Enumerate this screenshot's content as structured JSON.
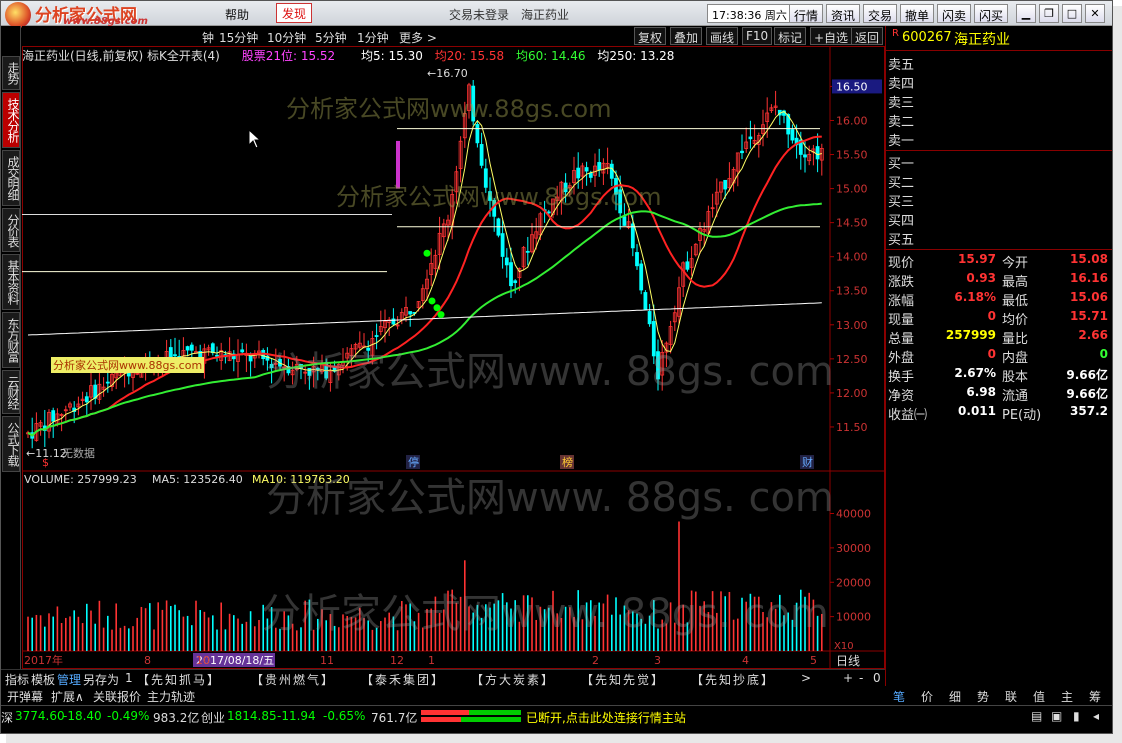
{
  "app": {
    "brand": "分析家公式网",
    "brand_url": "www.88gs.com",
    "menu_help": "帮助",
    "menu_discover": "发现",
    "trade_status": "交易未登录",
    "stock_title": "海正药业",
    "clock": "17:38:36 周六",
    "top_buttons": [
      "行情",
      "资讯",
      "交易",
      "撤单",
      "闪卖",
      "闪买"
    ]
  },
  "left_tabs": [
    "走势",
    "技术分析",
    "成交明细",
    "分价表",
    "基本资料",
    "东方财富",
    "云财经",
    "公式下载"
  ],
  "period_bar": {
    "periods": [
      "钟",
      "15分钟",
      "10分钟",
      "5分钟",
      "1分钟",
      "更多 >"
    ],
    "tools": [
      "复权",
      "叠加",
      "画线",
      "F10",
      "标记",
      "+自选",
      "返回"
    ]
  },
  "chart_header": {
    "name": "海正药业(日线,前复权) 标K全开表(4)",
    "items": [
      {
        "label": "股票21位: 15.52",
        "color": "#ff44ff"
      },
      {
        "label": "均5: 15.30",
        "color": "#ffffff"
      },
      {
        "label": "均20: 15.58",
        "color": "#ff3333"
      },
      {
        "label": "均60: 14.46",
        "color": "#33ff33"
      },
      {
        "label": "均250: 13.28",
        "color": "#ffffff"
      }
    ]
  },
  "chart_data": {
    "type": "candlestick",
    "y_ticks": [
      "16.50",
      "16.00",
      "15.50",
      "15.00",
      "14.50",
      "14.00",
      "13.50",
      "13.00",
      "12.50",
      "12.00",
      "11.50"
    ],
    "high_label": "16.70",
    "low_label": "11.12",
    "current_price_tag": "16.50",
    "x_labels": [
      "2017年",
      "8",
      "2017/08/18/五",
      "10",
      "11",
      "12",
      "1",
      "2",
      "3",
      "4",
      "5"
    ],
    "markers": [
      "停",
      "榜",
      "财"
    ],
    "no_data_label": "无数据",
    "period_label": "日线",
    "price_ylim": [
      11.0,
      16.8
    ],
    "volume_ticks": [
      "40000",
      "30000",
      "20000",
      "10000"
    ],
    "volume_unit": "X10",
    "volume_ylim": [
      0,
      48000
    ],
    "volume_header": {
      "volume": "VOLUME: 257999.23",
      "ma5": "MA5: 123526.40",
      "ma10": "MA10: 119763.20"
    }
  },
  "quote": {
    "code": "600267",
    "name": "海正药业",
    "sell_levels": [
      "卖五",
      "卖四",
      "卖三",
      "卖二",
      "卖一"
    ],
    "buy_levels": [
      "买一",
      "买二",
      "买三",
      "买四",
      "买五"
    ],
    "rows": [
      {
        "l1": "现价",
        "v1": "15.97",
        "c1": "#ff3333",
        "l2": "今开",
        "v2": "15.08",
        "c2": "#ff3333"
      },
      {
        "l1": "涨跌",
        "v1": "0.93",
        "c1": "#ff3333",
        "l2": "最高",
        "v2": "16.16",
        "c2": "#ff3333"
      },
      {
        "l1": "涨幅",
        "v1": "6.18%",
        "c1": "#ff3333",
        "l2": "最低",
        "v2": "15.06",
        "c2": "#ff3333"
      },
      {
        "l1": "现量",
        "v1": "0",
        "c1": "#ff3333",
        "l2": "均价",
        "v2": "15.71",
        "c2": "#ff3333"
      },
      {
        "l1": "总量",
        "v1": "257999",
        "c1": "#ffff00",
        "l2": "量比",
        "v2": "2.66",
        "c2": "#ff3333"
      },
      {
        "l1": "外盘",
        "v1": "0",
        "c1": "#ff3333",
        "l2": "内盘",
        "v2": "0",
        "c2": "#33ff33"
      },
      {
        "l1": "换手",
        "v1": "2.67%",
        "c1": "#ffffff",
        "l2": "股本",
        "v2": "9.66亿",
        "c2": "#ffffff"
      },
      {
        "l1": "净资",
        "v1": "6.98",
        "c1": "#ffffff",
        "l2": "流通",
        "v2": "9.66亿",
        "c2": "#ffffff"
      },
      {
        "l1": "收益㈠",
        "v1": "0.011",
        "c1": "#ffffff",
        "l2": "PE(动)",
        "v2": "357.2",
        "c2": "#ffffff"
      }
    ]
  },
  "bottom_tabs": [
    "指标",
    "模板",
    "管理",
    "另存为",
    "1",
    "【先知抓马】",
    "【贵州燃气】",
    "【泰禾集团】",
    "【方大炭素】",
    "【先知先觉】",
    "【先知抄底】",
    ">"
  ],
  "bottom2": [
    "开弹幕",
    "扩展∧",
    "关联报价",
    "主力轨迹"
  ],
  "right_tabs": [
    "笔",
    "价",
    "细",
    "势",
    "联",
    "值",
    "主",
    "筹"
  ],
  "status": {
    "idx1_name": "深",
    "idx1_value": "3774.60",
    "idx1_change": "-18.40",
    "idx1_pct": "-0.49%",
    "idx1_amount": "983.2亿",
    "idx2_name": "创业",
    "idx2_value": "1814.85",
    "idx2_change": "-11.94",
    "idx2_pct": "-0.65%",
    "idx2_amount": "761.7亿",
    "message": "已断开,点击此处连接行情主站"
  },
  "watermarks": {
    "main": "分析家公式网www.88gs.com",
    "wide": "分析家公式网www. 88gs. com",
    "label": "分析家公式网www.88gs.com"
  },
  "colors": {
    "up": "#ff3333",
    "down": "#00ffff",
    "ma5": "#ffff66",
    "ma20": "#ff2222",
    "ma60": "#33ee33",
    "ma250": "#ffffff"
  }
}
